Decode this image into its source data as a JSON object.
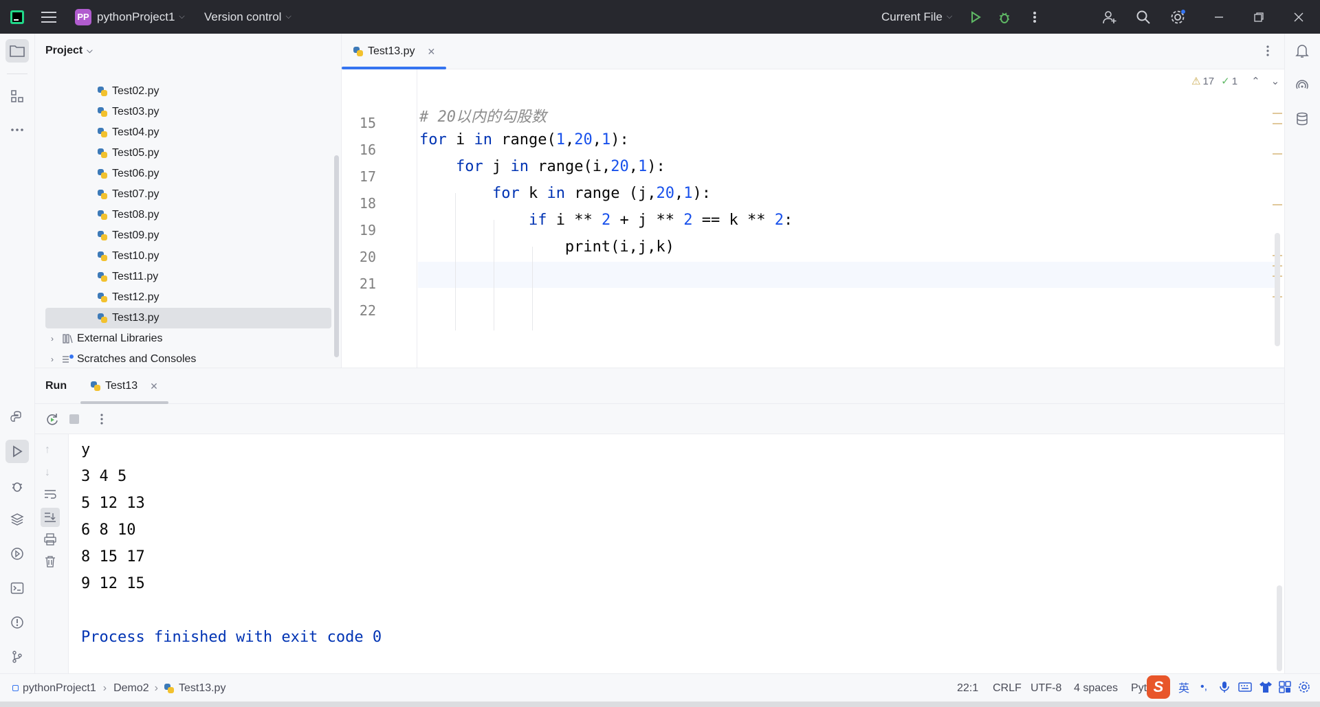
{
  "titlebar": {
    "project_badge": "PP",
    "project_name": "pythonProject1",
    "vcs_label": "Version control",
    "run_config": "Current File"
  },
  "project_panel": {
    "title": "Project",
    "files": [
      "Test02.py",
      "Test03.py",
      "Test04.py",
      "Test05.py",
      "Test06.py",
      "Test07.py",
      "Test08.py",
      "Test09.py",
      "Test10.py",
      "Test11.py",
      "Test12.py",
      "Test13.py"
    ],
    "selected_file": "Test13.py",
    "external_libraries": "External Libraries",
    "scratches": "Scratches and Consoles"
  },
  "editor": {
    "tab_label": "Test13.py",
    "warnings_count": "17",
    "checks_count": "1",
    "line_numbers": [
      "15",
      "16",
      "17",
      "18",
      "19",
      "20",
      "21",
      "22"
    ],
    "lines": [
      "",
      "# 20以内的勾股数",
      "for i in range(1,20,1):",
      "    for j in range(i,20,1):",
      "        for k in range (j,20,1):",
      "            if i ** 2 + j ** 2 == k ** 2:",
      "                print(i,j,k)",
      ""
    ]
  },
  "run_panel": {
    "title": "Run",
    "tab_label": "Test13",
    "output": [
      "y",
      "3 4 5",
      "5 12 13",
      "6 8 10",
      "8 15 17",
      "9 12 15",
      "",
      "Process finished with exit code 0"
    ]
  },
  "statusbar": {
    "breadcrumb": [
      "pythonProject1",
      "Demo2",
      "Test13.py"
    ],
    "position": "22:1",
    "line_sep": "CRLF",
    "encoding": "UTF-8",
    "indent": "4 spaces",
    "interpreter": "Pyt",
    "ime_lang": "英"
  },
  "colors": {
    "accent": "#3574f0",
    "titlebar_bg": "#27282e",
    "keyword": "#0033b3",
    "number": "#1750eb"
  }
}
